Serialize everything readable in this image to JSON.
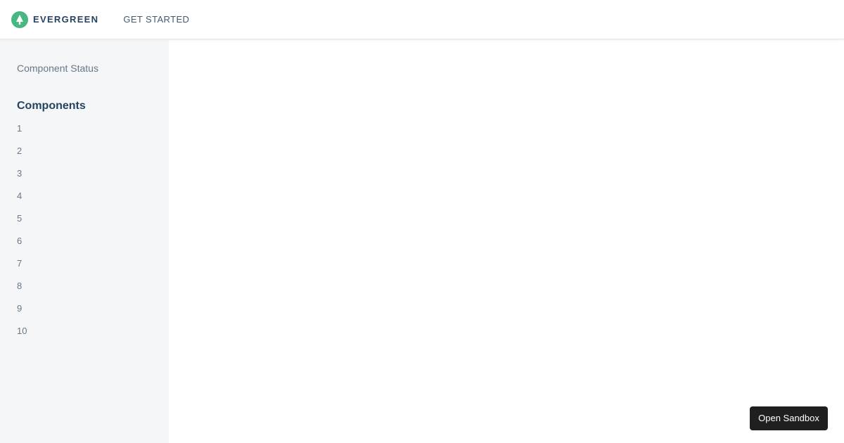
{
  "header": {
    "logo_text": "EVERGREEN",
    "nav_link": "GET STARTED",
    "logo_icon": "evergreen-tree-icon",
    "logo_color": "#47b881"
  },
  "sidebar": {
    "status_link": "Component Status",
    "heading": "Components",
    "items": [
      "1",
      "2",
      "3",
      "4",
      "5",
      "6",
      "7",
      "8",
      "9",
      "10"
    ]
  },
  "sandbox_button": {
    "label": "Open Sandbox"
  }
}
